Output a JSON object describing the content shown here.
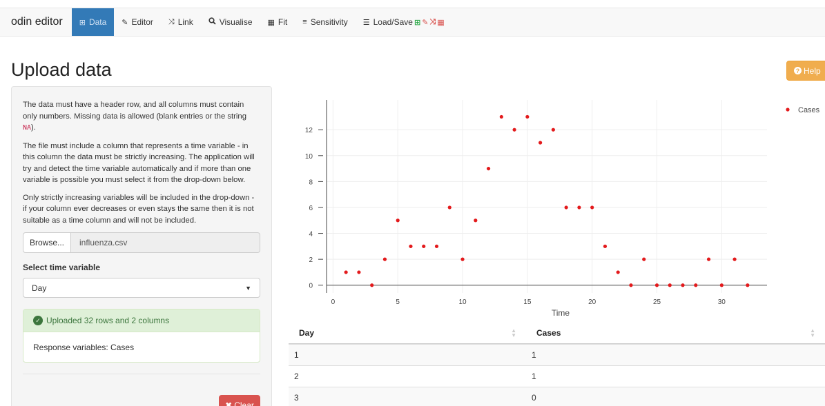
{
  "navbar": {
    "brand": "odin editor",
    "items": [
      {
        "label": "Data",
        "icon": "table-icon",
        "glyph": "⊞",
        "active": true
      },
      {
        "label": "Editor",
        "icon": "edit-icon",
        "glyph": "✎",
        "active": false
      },
      {
        "label": "Link",
        "icon": "shuffle-icon",
        "glyph": "⤨",
        "active": false
      },
      {
        "label": "Visualise",
        "icon": "search-icon",
        "glyph": "🔍",
        "active": false
      },
      {
        "label": "Fit",
        "icon": "calculator-icon",
        "glyph": "▦",
        "active": false
      },
      {
        "label": "Sensitivity",
        "icon": "bars-icon",
        "glyph": "≡",
        "active": false
      },
      {
        "label": "Load/Save",
        "icon": "list-icon",
        "glyph": "☰",
        "active": false
      }
    ]
  },
  "page": {
    "title": "Upload data",
    "help_label": "Help"
  },
  "sidebar": {
    "para1_pre": "The data must have a header row, and all columns must contain only numbers. Missing data is allowed (blank entries or the string",
    "para1_code": "NA",
    "para1_post": ").",
    "para2": "The file must include a column that represents a time variable - in this column the data must be strictly increasing. The application will try and detect the time variable automatically and if more than one variable is possible you must select it from the drop-down below.",
    "para3": "Only strictly increasing variables will be included in the drop-down - if your column ever decreases or even stays the same then it is not suitable as a time column and will not be included.",
    "browse_label": "Browse...",
    "file_name": "influenza.csv",
    "select_label": "Select time variable",
    "select_value": "Day",
    "status_message": "Uploaded 32 rows and 2 columns",
    "response_text": "Response variables: Cases",
    "clear_label": "Clear"
  },
  "chart_data": {
    "type": "scatter",
    "xlabel": "Time",
    "ylabel": "",
    "xlim": [
      -0.5,
      33.5
    ],
    "ylim": [
      -0.6,
      14.3
    ],
    "xticks": [
      0,
      5,
      10,
      15,
      20,
      25,
      30
    ],
    "yticks": [
      0,
      2,
      4,
      6,
      8,
      10,
      12
    ],
    "grid": true,
    "legend": "top-right",
    "color": "#e31a1c",
    "series": [
      {
        "name": "Cases",
        "x": [
          1,
          2,
          3,
          4,
          5,
          6,
          7,
          8,
          9,
          10,
          11,
          12,
          13,
          14,
          15,
          16,
          17,
          18,
          19,
          20,
          21,
          22,
          23,
          24,
          25,
          26,
          27,
          28,
          29,
          30,
          31,
          32
        ],
        "y": [
          1,
          1,
          0,
          2,
          5,
          3,
          3,
          3,
          6,
          2,
          5,
          9,
          13,
          12,
          13,
          11,
          12,
          6,
          6,
          6,
          3,
          1,
          0,
          2,
          0,
          0,
          0,
          0,
          2,
          0,
          2,
          0
        ]
      }
    ]
  },
  "table": {
    "columns": [
      "Day",
      "Cases"
    ],
    "rows": [
      [
        "1",
        "1"
      ],
      [
        "2",
        "1"
      ],
      [
        "3",
        "0"
      ]
    ]
  }
}
